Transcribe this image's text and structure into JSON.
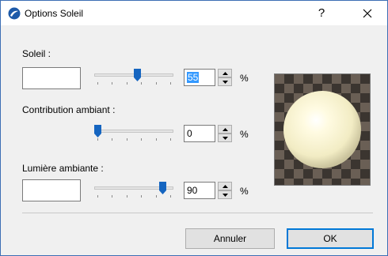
{
  "window": {
    "title": "Options Soleil",
    "help_label": "?",
    "close_icon": "close-icon"
  },
  "soleil": {
    "label": "Soleil :",
    "value": "55",
    "unit": "%",
    "slider_fraction": 0.55
  },
  "contribution": {
    "label": "Contribution ambiant :",
    "value": "0",
    "unit": "%",
    "slider_fraction": 0.0
  },
  "lumiere": {
    "label": "Lumière ambiante :",
    "value": "90",
    "unit": "%",
    "slider_fraction": 0.9
  },
  "buttons": {
    "cancel": "Annuler",
    "ok": "OK"
  },
  "colors": {
    "accent": "#0078d7",
    "slider_thumb": "#1565c0",
    "selection": "#3399ff"
  }
}
